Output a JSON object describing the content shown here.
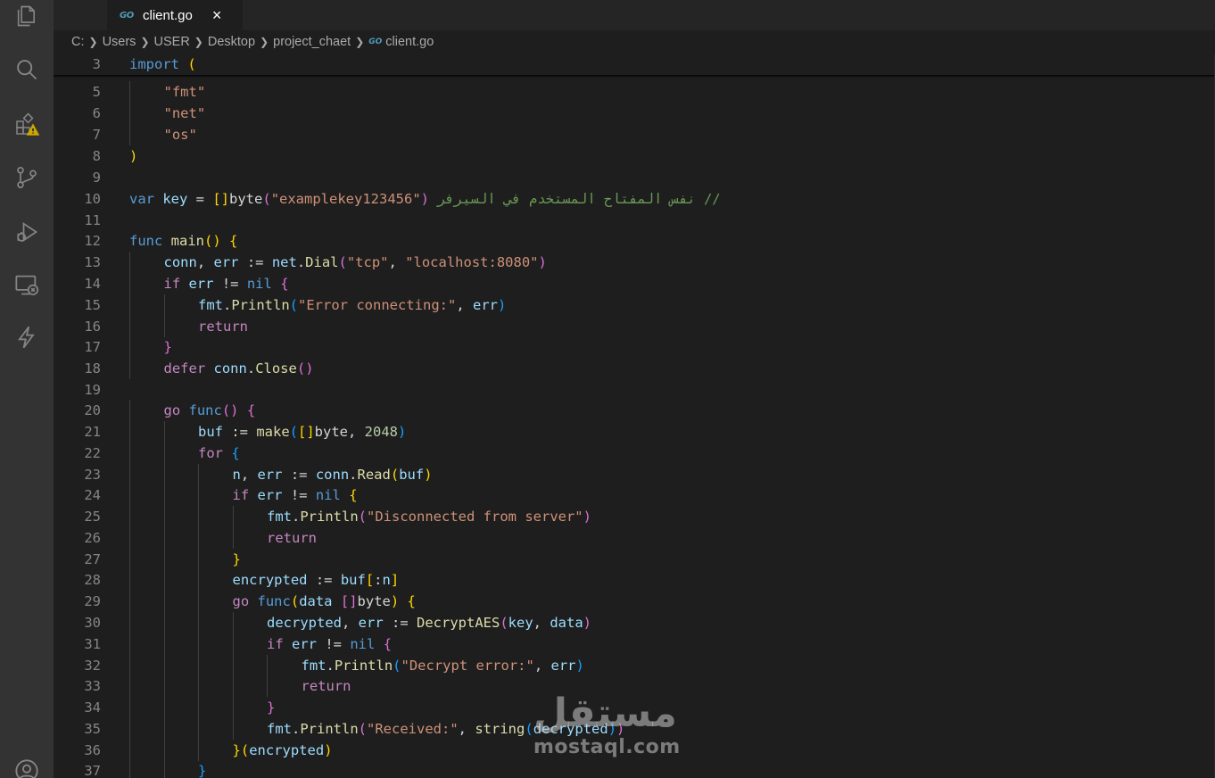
{
  "tab": {
    "icon": "go-file-icon",
    "icon_text": "GO",
    "label": "client.go",
    "close": "×"
  },
  "breadcrumb": {
    "parts": [
      "C:",
      "Users",
      "USER",
      "Desktop",
      "project_chaet",
      "client.go"
    ],
    "file_icon_text": "GO"
  },
  "activity_bar": {
    "icons": [
      "explorer-icon",
      "search-icon",
      "extensions-warning-icon",
      "source-control-icon",
      "run-debug-icon",
      "remote-explorer-icon",
      "lightning-icon",
      "account-icon"
    ]
  },
  "editor": {
    "lines": [
      {
        "n": "3",
        "indent": 0,
        "tokens": [
          [
            "kw",
            "import"
          ],
          [
            "plain",
            " "
          ],
          [
            "b1",
            "("
          ]
        ]
      },
      {
        "n": "5",
        "indent": 1,
        "tokens": [
          [
            "str",
            "\"fmt\""
          ]
        ]
      },
      {
        "n": "6",
        "indent": 1,
        "tokens": [
          [
            "str",
            "\"net\""
          ]
        ]
      },
      {
        "n": "7",
        "indent": 1,
        "tokens": [
          [
            "str",
            "\"os\""
          ]
        ]
      },
      {
        "n": "8",
        "indent": 0,
        "tokens": [
          [
            "b1",
            ")"
          ]
        ]
      },
      {
        "n": "9",
        "indent": 0,
        "tokens": []
      },
      {
        "n": "10",
        "indent": 0,
        "tokens": [
          [
            "kw",
            "var"
          ],
          [
            "plain",
            " "
          ],
          [
            "var",
            "key"
          ],
          [
            "plain",
            " = "
          ],
          [
            "b1",
            "[]"
          ],
          [
            "plain",
            "byte"
          ],
          [
            "b2",
            "("
          ],
          [
            "str",
            "\"examplekey123456\""
          ],
          [
            "b2",
            ")"
          ],
          [
            "plain",
            " "
          ],
          [
            "cmt",
            "// نفس المفتاح المستخدم في السيرفر"
          ]
        ]
      },
      {
        "n": "11",
        "indent": 0,
        "tokens": []
      },
      {
        "n": "12",
        "indent": 0,
        "tokens": [
          [
            "kw",
            "func"
          ],
          [
            "plain",
            " "
          ],
          [
            "fn",
            "main"
          ],
          [
            "b1",
            "()"
          ],
          [
            "plain",
            " "
          ],
          [
            "b1",
            "{"
          ]
        ]
      },
      {
        "n": "13",
        "indent": 1,
        "tokens": [
          [
            "var",
            "conn"
          ],
          [
            "plain",
            ", "
          ],
          [
            "var",
            "err"
          ],
          [
            "plain",
            " := "
          ],
          [
            "var",
            "net"
          ],
          [
            "plain",
            "."
          ],
          [
            "fn",
            "Dial"
          ],
          [
            "b2",
            "("
          ],
          [
            "str",
            "\"tcp\""
          ],
          [
            "plain",
            ", "
          ],
          [
            "str",
            "\"localhost:8080\""
          ],
          [
            "b2",
            ")"
          ]
        ]
      },
      {
        "n": "14",
        "indent": 1,
        "tokens": [
          [
            "ctl",
            "if"
          ],
          [
            "plain",
            " "
          ],
          [
            "var",
            "err"
          ],
          [
            "plain",
            " != "
          ],
          [
            "kw",
            "nil"
          ],
          [
            "plain",
            " "
          ],
          [
            "b2",
            "{"
          ]
        ]
      },
      {
        "n": "15",
        "indent": 2,
        "tokens": [
          [
            "var",
            "fmt"
          ],
          [
            "plain",
            "."
          ],
          [
            "fn",
            "Println"
          ],
          [
            "b3",
            "("
          ],
          [
            "str",
            "\"Error connecting:\""
          ],
          [
            "plain",
            ", "
          ],
          [
            "var",
            "err"
          ],
          [
            "b3",
            ")"
          ]
        ]
      },
      {
        "n": "16",
        "indent": 2,
        "tokens": [
          [
            "ctl",
            "return"
          ]
        ]
      },
      {
        "n": "17",
        "indent": 1,
        "tokens": [
          [
            "b2",
            "}"
          ]
        ]
      },
      {
        "n": "18",
        "indent": 1,
        "tokens": [
          [
            "ctl",
            "defer"
          ],
          [
            "plain",
            " "
          ],
          [
            "var",
            "conn"
          ],
          [
            "plain",
            "."
          ],
          [
            "fn",
            "Close"
          ],
          [
            "b2",
            "()"
          ]
        ]
      },
      {
        "n": "19",
        "indent": 0,
        "tokens": []
      },
      {
        "n": "20",
        "indent": 1,
        "tokens": [
          [
            "ctl",
            "go"
          ],
          [
            "plain",
            " "
          ],
          [
            "kw",
            "func"
          ],
          [
            "b2",
            "()"
          ],
          [
            "plain",
            " "
          ],
          [
            "b2",
            "{"
          ]
        ]
      },
      {
        "n": "21",
        "indent": 2,
        "tokens": [
          [
            "var",
            "buf"
          ],
          [
            "plain",
            " := "
          ],
          [
            "fn",
            "make"
          ],
          [
            "b3",
            "("
          ],
          [
            "b1",
            "[]"
          ],
          [
            "plain",
            "byte, "
          ],
          [
            "num",
            "2048"
          ],
          [
            "b3",
            ")"
          ]
        ]
      },
      {
        "n": "22",
        "indent": 2,
        "tokens": [
          [
            "ctl",
            "for"
          ],
          [
            "plain",
            " "
          ],
          [
            "b3",
            "{"
          ]
        ]
      },
      {
        "n": "23",
        "indent": 3,
        "tokens": [
          [
            "var",
            "n"
          ],
          [
            "plain",
            ", "
          ],
          [
            "var",
            "err"
          ],
          [
            "plain",
            " := "
          ],
          [
            "var",
            "conn"
          ],
          [
            "plain",
            "."
          ],
          [
            "fn",
            "Read"
          ],
          [
            "b1",
            "("
          ],
          [
            "var",
            "buf"
          ],
          [
            "b1",
            ")"
          ]
        ]
      },
      {
        "n": "24",
        "indent": 3,
        "tokens": [
          [
            "ctl",
            "if"
          ],
          [
            "plain",
            " "
          ],
          [
            "var",
            "err"
          ],
          [
            "plain",
            " != "
          ],
          [
            "kw",
            "nil"
          ],
          [
            "plain",
            " "
          ],
          [
            "b1",
            "{"
          ]
        ]
      },
      {
        "n": "25",
        "indent": 4,
        "tokens": [
          [
            "var",
            "fmt"
          ],
          [
            "plain",
            "."
          ],
          [
            "fn",
            "Println"
          ],
          [
            "b2",
            "("
          ],
          [
            "str",
            "\"Disconnected from server\""
          ],
          [
            "b2",
            ")"
          ]
        ]
      },
      {
        "n": "26",
        "indent": 4,
        "tokens": [
          [
            "ctl",
            "return"
          ]
        ]
      },
      {
        "n": "27",
        "indent": 3,
        "tokens": [
          [
            "b1",
            "}"
          ]
        ]
      },
      {
        "n": "28",
        "indent": 3,
        "tokens": [
          [
            "var",
            "encrypted"
          ],
          [
            "plain",
            " := "
          ],
          [
            "var",
            "buf"
          ],
          [
            "b1",
            "["
          ],
          [
            "plain",
            ":"
          ],
          [
            "var",
            "n"
          ],
          [
            "b1",
            "]"
          ]
        ]
      },
      {
        "n": "29",
        "indent": 3,
        "tokens": [
          [
            "ctl",
            "go"
          ],
          [
            "plain",
            " "
          ],
          [
            "kw",
            "func"
          ],
          [
            "b1",
            "("
          ],
          [
            "var",
            "data"
          ],
          [
            "plain",
            " "
          ],
          [
            "b2",
            "[]"
          ],
          [
            "plain",
            "byte"
          ],
          [
            "b1",
            ")"
          ],
          [
            "plain",
            " "
          ],
          [
            "b1",
            "{"
          ]
        ]
      },
      {
        "n": "30",
        "indent": 4,
        "tokens": [
          [
            "var",
            "decrypted"
          ],
          [
            "plain",
            ", "
          ],
          [
            "var",
            "err"
          ],
          [
            "plain",
            " := "
          ],
          [
            "fn",
            "DecryptAES"
          ],
          [
            "b2",
            "("
          ],
          [
            "var",
            "key"
          ],
          [
            "plain",
            ", "
          ],
          [
            "var",
            "data"
          ],
          [
            "b2",
            ")"
          ]
        ]
      },
      {
        "n": "31",
        "indent": 4,
        "tokens": [
          [
            "ctl",
            "if"
          ],
          [
            "plain",
            " "
          ],
          [
            "var",
            "err"
          ],
          [
            "plain",
            " != "
          ],
          [
            "kw",
            "nil"
          ],
          [
            "plain",
            " "
          ],
          [
            "b2",
            "{"
          ]
        ]
      },
      {
        "n": "32",
        "indent": 5,
        "tokens": [
          [
            "var",
            "fmt"
          ],
          [
            "plain",
            "."
          ],
          [
            "fn",
            "Println"
          ],
          [
            "b3",
            "("
          ],
          [
            "str",
            "\"Decrypt error:\""
          ],
          [
            "plain",
            ", "
          ],
          [
            "var",
            "err"
          ],
          [
            "b3",
            ")"
          ]
        ]
      },
      {
        "n": "33",
        "indent": 5,
        "tokens": [
          [
            "ctl",
            "return"
          ]
        ]
      },
      {
        "n": "34",
        "indent": 4,
        "tokens": [
          [
            "b2",
            "}"
          ]
        ]
      },
      {
        "n": "35",
        "indent": 4,
        "tokens": [
          [
            "var",
            "fmt"
          ],
          [
            "plain",
            "."
          ],
          [
            "fn",
            "Println"
          ],
          [
            "b2",
            "("
          ],
          [
            "str",
            "\"Received:\""
          ],
          [
            "plain",
            ", "
          ],
          [
            "fn",
            "string"
          ],
          [
            "b3",
            "("
          ],
          [
            "var",
            "decrypted"
          ],
          [
            "b3",
            ")"
          ],
          [
            "b2",
            ")"
          ]
        ]
      },
      {
        "n": "36",
        "indent": 3,
        "tokens": [
          [
            "b1",
            "}"
          ],
          [
            "b1",
            "("
          ],
          [
            "var",
            "encrypted"
          ],
          [
            "b1",
            ")"
          ]
        ]
      },
      {
        "n": "37",
        "indent": 2,
        "tokens": [
          [
            "b3",
            "}"
          ]
        ]
      }
    ]
  },
  "watermark": {
    "arabic": "مستقل",
    "latin": "mostaql.com"
  }
}
